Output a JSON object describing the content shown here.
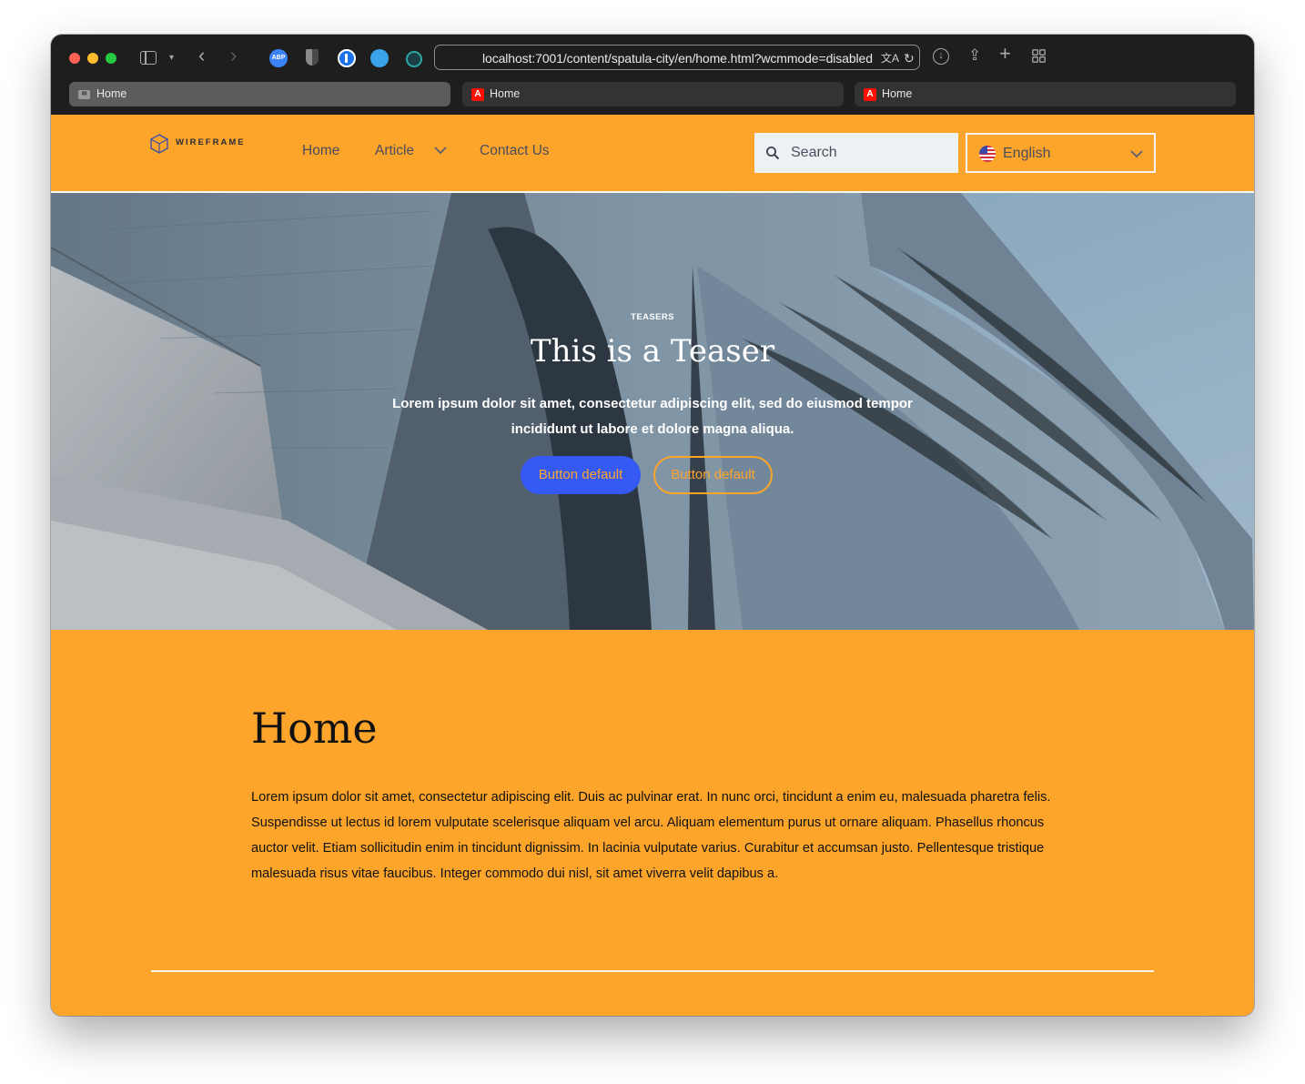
{
  "browser": {
    "url": "localhost:7001/content/spatula-city/en/home.html?wcmmode=disabled",
    "extensions": [
      "abp-icon",
      "shield-icon",
      "password-manager-icon",
      "bird-icon",
      "circle-extension-icon"
    ],
    "tabs": [
      {
        "title": "Home",
        "favicon": "generic-favicon",
        "active": true
      },
      {
        "title": "Home",
        "favicon": "adobe-favicon",
        "active": false
      },
      {
        "title": "Home",
        "favicon": "adobe-favicon",
        "active": false
      }
    ],
    "abp_label": "ABP"
  },
  "header": {
    "logo_text": "WIREFRAME",
    "nav": [
      {
        "label": "Home"
      },
      {
        "label": "Article",
        "has_submenu": true
      },
      {
        "label": "Contact Us"
      }
    ],
    "search_placeholder": "Search",
    "language": "English"
  },
  "hero": {
    "eyebrow": "TEASERS",
    "title": "This is a Teaser",
    "description": "Lorem ipsum dolor sit amet, consectetur adipiscing elit, sed do eiusmod tempor incididunt ut labore et dolore magna aliqua.",
    "primary_button": "Button default",
    "secondary_button": "Button default"
  },
  "main": {
    "title": "Home",
    "body": "Lorem ipsum dolor sit amet, consectetur adipiscing elit. Duis ac pulvinar erat. In nunc orci, tincidunt a enim eu, malesuada pharetra felis. Suspendisse ut lectus id lorem vulputate scelerisque aliquam vel arcu. Aliquam elementum purus ut ornare aliquam. Phasellus rhoncus auctor velit. Etiam sollicitudin enim in tincidunt dignissim. In lacinia vulputate varius. Curabitur et accumsan justo. Pellentesque tristique malesuada risus vitae faucibus. Integer commodo dui nisl, sit amet viverra velit dapibus a."
  },
  "colors": {
    "brand_orange": "#fda42b",
    "primary_button": "#3559f5",
    "chrome_dark": "#1e1e1f",
    "nav_text": "#4a4d5e"
  }
}
